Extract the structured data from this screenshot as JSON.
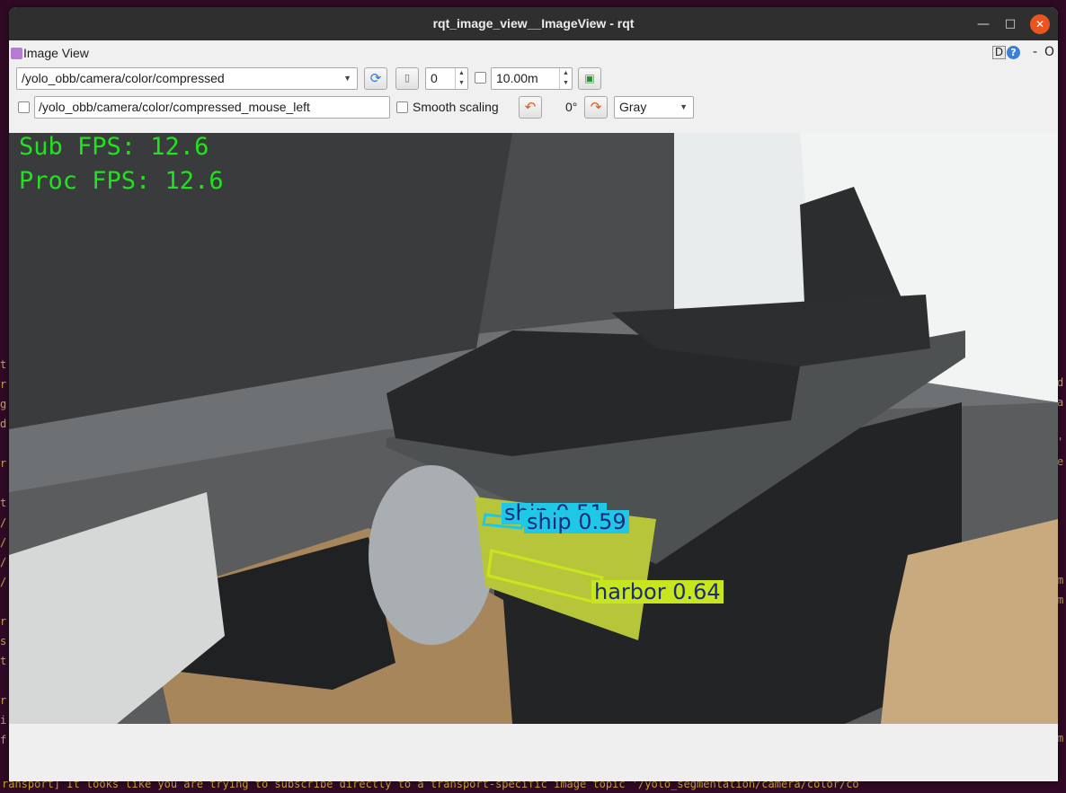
{
  "window": {
    "title": "rqt_image_view__ImageView - rqt"
  },
  "plugin": {
    "title": "Image View",
    "d_label": "D",
    "help_label": "?",
    "dash_label": "-",
    "o_label": "O"
  },
  "toolbar": {
    "topic": "/yolo_obb/camera/color/compressed",
    "zoom_value": "0",
    "duration_value": "10.00m",
    "mouse_topic": "/yolo_obb/camera/color/compressed_mouse_left",
    "smooth_label": "Smooth scaling",
    "rotation_label": "0°",
    "color_scheme": "Gray"
  },
  "overlay": {
    "sub_fps": "Sub FPS: 12.6",
    "proc_fps": "Proc FPS: 12.6"
  },
  "detections": [
    {
      "label": "ship 0.51",
      "color": "#1ec8e6",
      "text_color": "#1b2a7a"
    },
    {
      "label": "ship 0.59",
      "color": "#1ec8e6",
      "text_color": "#1b2a7a"
    },
    {
      "label": "harbor 0.64",
      "color": "#c8e61e",
      "text_color": "#1b2a7a"
    }
  ],
  "terminal": {
    "bottom_line": "ransport] It looks like you are trying to subscribe directly to a transport-specific image topic '/yolo_segmentation/camera/color/co"
  },
  "colors": {
    "accent": "#e95420",
    "fps_green": "#21e21f"
  }
}
